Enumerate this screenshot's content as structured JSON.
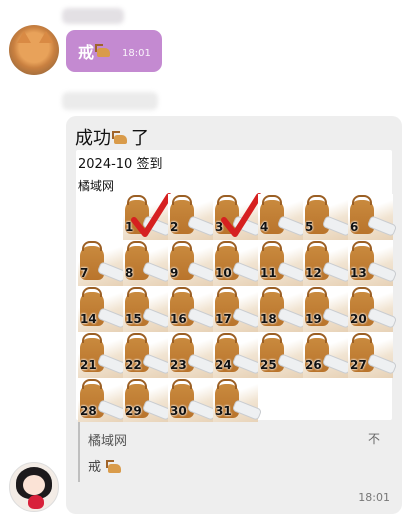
{
  "message1": {
    "text": "戒",
    "emoji": "deer-emoji",
    "time": "18:01"
  },
  "card": {
    "title": "成功",
    "title_suffix": "了",
    "title_emoji": "deer-emoji",
    "calendar": {
      "month": "2024-10 签到",
      "org": "橘域网",
      "days": [
        "1",
        "2",
        "3",
        "4",
        "5",
        "6",
        "7",
        "8",
        "9",
        "10",
        "11",
        "12",
        "13",
        "14",
        "15",
        "16",
        "17",
        "18",
        "19",
        "20",
        "21",
        "22",
        "23",
        "24",
        "25",
        "26",
        "27",
        "28",
        "29",
        "30",
        "31"
      ],
      "checked_days": [
        "1",
        "3"
      ]
    },
    "quote": {
      "name": "橘域网",
      "right": "不",
      "message": "戒",
      "emoji": "deer-emoji"
    },
    "time": "18:01"
  },
  "colors": {
    "bubble": "#c48ad1",
    "card_bg": "#eeeeee",
    "check": "#d62020"
  }
}
